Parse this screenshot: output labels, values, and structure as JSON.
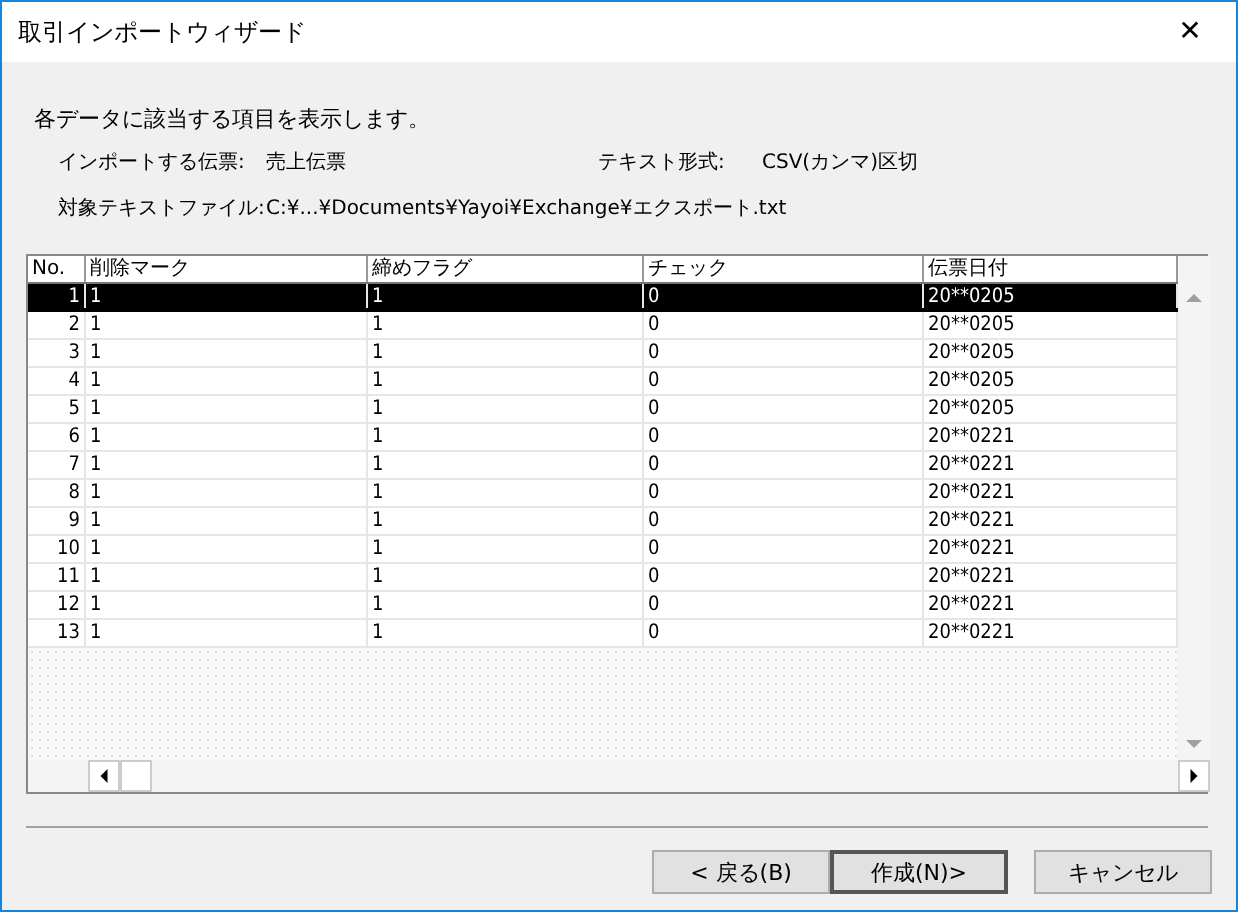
{
  "window": {
    "title": "取引インポートウィザード",
    "close": "✕"
  },
  "intro": "各データに該当する項目を表示します。",
  "fields": [
    {
      "label": "インポートする伝票:",
      "value": "売上伝票"
    },
    {
      "label": "テキスト形式:",
      "value": "CSV(カンマ)区切"
    },
    {
      "label": "対象テキストファイル:",
      "value": "C:¥...¥Documents¥Yayoi¥Exchange¥エクスポート.txt"
    }
  ],
  "table": {
    "columns": [
      "No.",
      "削除マーク",
      "締めフラグ",
      "チェック",
      "伝票日付"
    ],
    "rows": [
      {
        "cells": [
          "1",
          "1",
          "1",
          "0",
          "20**0205"
        ],
        "selected": true
      },
      {
        "cells": [
          "2",
          "1",
          "1",
          "0",
          "20**0205"
        ],
        "selected": false
      },
      {
        "cells": [
          "3",
          "1",
          "1",
          "0",
          "20**0205"
        ],
        "selected": false
      },
      {
        "cells": [
          "4",
          "1",
          "1",
          "0",
          "20**0205"
        ],
        "selected": false
      },
      {
        "cells": [
          "5",
          "1",
          "1",
          "0",
          "20**0205"
        ],
        "selected": false
      },
      {
        "cells": [
          "6",
          "1",
          "1",
          "0",
          "20**0221"
        ],
        "selected": false
      },
      {
        "cells": [
          "7",
          "1",
          "1",
          "0",
          "20**0221"
        ],
        "selected": false
      },
      {
        "cells": [
          "8",
          "1",
          "1",
          "0",
          "20**0221"
        ],
        "selected": false
      },
      {
        "cells": [
          "9",
          "1",
          "1",
          "0",
          "20**0221"
        ],
        "selected": false
      },
      {
        "cells": [
          "10",
          "1",
          "1",
          "0",
          "20**0221"
        ],
        "selected": false
      },
      {
        "cells": [
          "11",
          "1",
          "1",
          "0",
          "20**0221"
        ],
        "selected": false
      },
      {
        "cells": [
          "12",
          "1",
          "1",
          "0",
          "20**0221"
        ],
        "selected": false
      },
      {
        "cells": [
          "13",
          "1",
          "1",
          "0",
          "20**0221"
        ],
        "selected": false
      }
    ]
  },
  "buttons": [
    {
      "label": "< 戻る(B)",
      "default": false
    },
    {
      "label": "作成(N)>",
      "default": true
    },
    {
      "label": "キャンセル",
      "default": false
    }
  ]
}
